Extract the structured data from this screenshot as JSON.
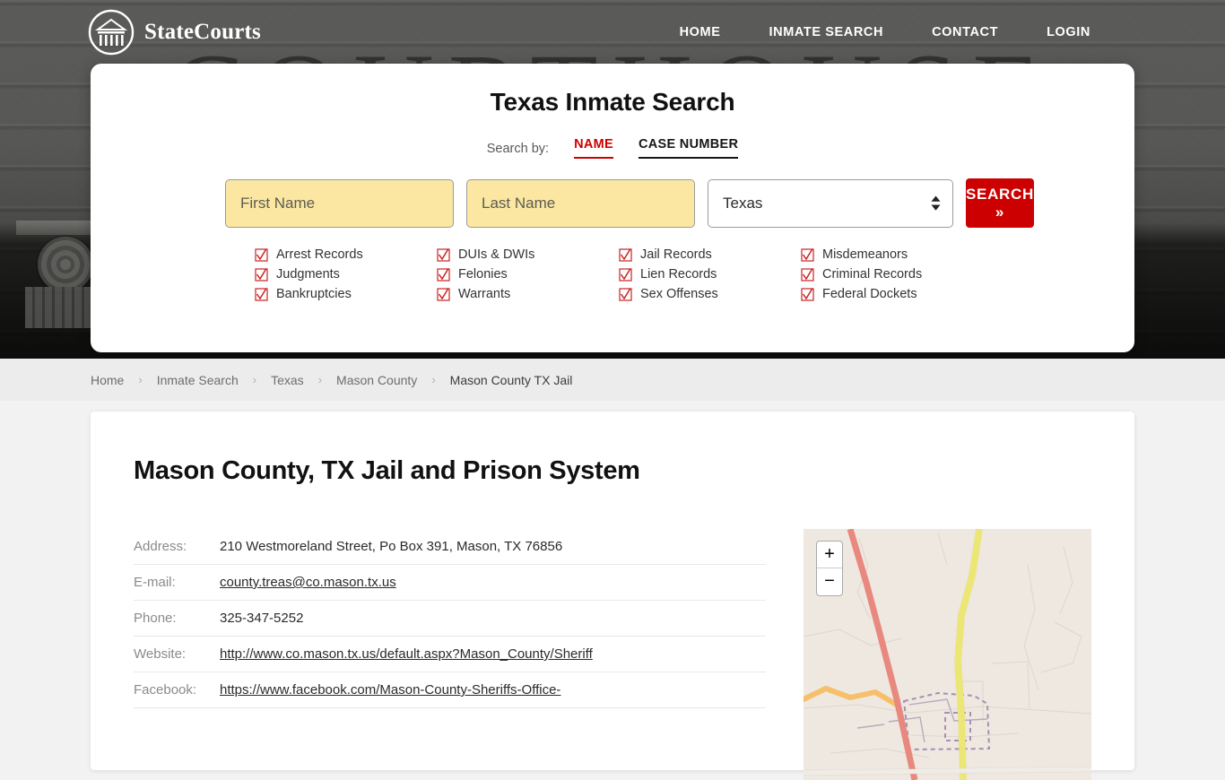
{
  "header": {
    "brand_name": "StateCourts",
    "logo_icon": "courthouse-circle-icon",
    "nav": [
      {
        "label": "HOME"
      },
      {
        "label": "INMATE SEARCH"
      },
      {
        "label": "CONTACT"
      },
      {
        "label": "LOGIN"
      }
    ]
  },
  "hero": {
    "background_word": "COURTHOUSE"
  },
  "search_card": {
    "title": "Texas Inmate Search",
    "search_by_label": "Search by:",
    "tabs": [
      {
        "label": "NAME",
        "active": true
      },
      {
        "label": "CASE NUMBER",
        "active": false
      }
    ],
    "first_name": {
      "value": "",
      "placeholder": "First Name"
    },
    "last_name": {
      "value": "",
      "placeholder": "Last Name"
    },
    "state_select": {
      "value": "Texas"
    },
    "search_button": "SEARCH",
    "search_button_chevron": "»",
    "accent_red": "#cc0000",
    "autofill_yellow": "#fbe7a2",
    "record_types": [
      "Arrest Records",
      "DUIs & DWIs",
      "Jail Records",
      "Misdemeanors",
      "Judgments",
      "Felonies",
      "Lien Records",
      "Criminal Records",
      "Bankruptcies",
      "Warrants",
      "Sex Offenses",
      "Federal Dockets"
    ]
  },
  "breadcrumb": {
    "separator": "›",
    "items": [
      {
        "label": "Home",
        "current": false
      },
      {
        "label": "Inmate Search",
        "current": false
      },
      {
        "label": "Texas",
        "current": false
      },
      {
        "label": "Mason County",
        "current": false
      },
      {
        "label": "Mason County TX Jail",
        "current": true
      }
    ]
  },
  "main": {
    "page_title": "Mason County, TX Jail and Prison System",
    "details": [
      {
        "label": "Address:",
        "value": "210 Westmoreland Street, Po Box 391, Mason, TX 76856",
        "link": false
      },
      {
        "label": "E-mail:",
        "value": "county.treas@co.mason.tx.us",
        "link": true
      },
      {
        "label": "Phone:",
        "value": "325-347-5252",
        "link": false
      },
      {
        "label": "Website:",
        "value": "http://www.co.mason.tx.us/default.aspx?Mason_County/Sheriff",
        "link": true
      },
      {
        "label": "Facebook:",
        "value": "https://www.facebook.com/Mason-County-Sheriffs-Office-",
        "link": true
      }
    ],
    "map": {
      "zoom_in_label": "+",
      "zoom_out_label": "−"
    }
  }
}
